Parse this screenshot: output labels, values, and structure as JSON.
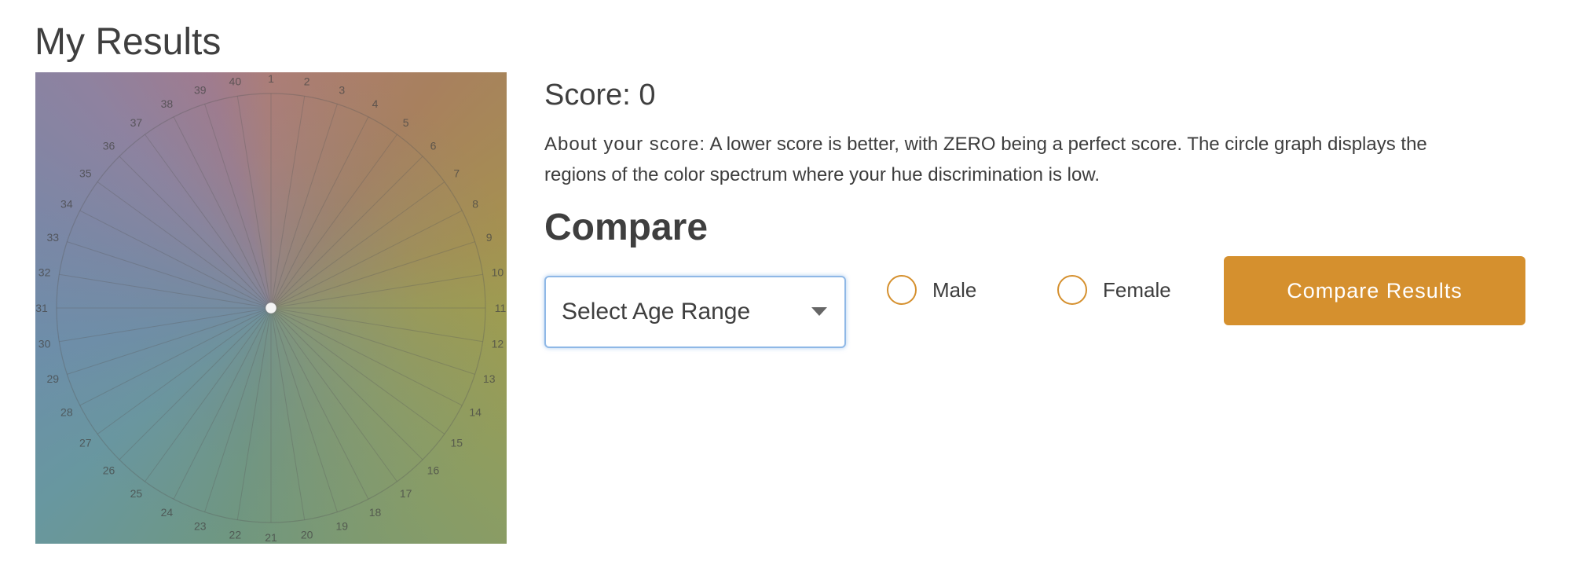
{
  "page_title": "My Results",
  "graph": {
    "spoke_labels": [
      "1",
      "2",
      "3",
      "4",
      "5",
      "6",
      "7",
      "8",
      "9",
      "10",
      "11",
      "12",
      "13",
      "14",
      "15",
      "16",
      "17",
      "18",
      "19",
      "20",
      "21",
      "22",
      "23",
      "24",
      "25",
      "26",
      "27",
      "28",
      "29",
      "30",
      "31",
      "32",
      "33",
      "34",
      "35",
      "36",
      "37",
      "38",
      "39",
      "40"
    ]
  },
  "score": {
    "text": "Score: 0"
  },
  "about": {
    "label": "About your score:",
    "text": " A lower score is better, with ZERO being a perfect score. The circle graph displays the regions of the color spectrum where your hue discrimination is low."
  },
  "compare": {
    "heading": "Compare",
    "age_select": {
      "value": "Select Age Range",
      "icon": "chevron-down-icon"
    },
    "gender_options": [
      "Male",
      "Female"
    ],
    "button_label": "Compare Results"
  },
  "colors": {
    "accent": "#d5902e",
    "select_focus_border": "#8fb8e6",
    "text": "#3f3f3f"
  }
}
